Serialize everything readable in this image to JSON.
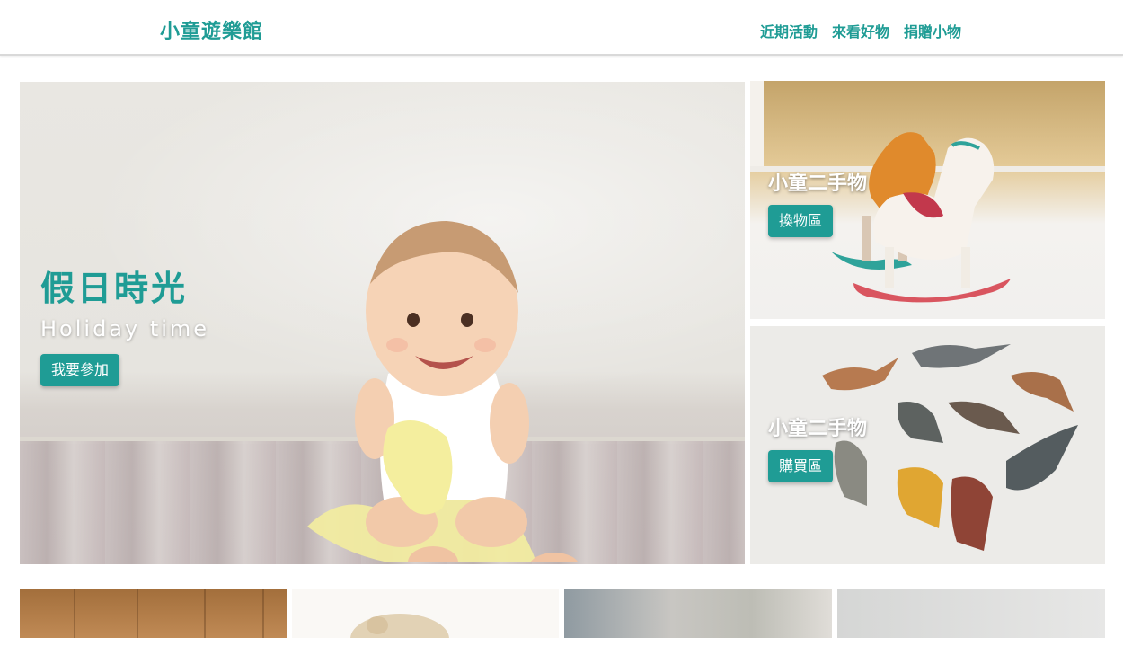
{
  "header": {
    "logo": "小童遊樂館",
    "nav": [
      "近期活動",
      "來看好物",
      "捐贈小物"
    ]
  },
  "hero": {
    "title": "假日時光",
    "subtitle": "Holiday time",
    "button": "我要參加"
  },
  "side_cards": [
    {
      "title": "小童二手物",
      "button": "換物區"
    },
    {
      "title": "小童二手物",
      "button": "購買區"
    }
  ],
  "colors": {
    "accent": "#1f9c95",
    "header_border": "#d9d9d9"
  }
}
